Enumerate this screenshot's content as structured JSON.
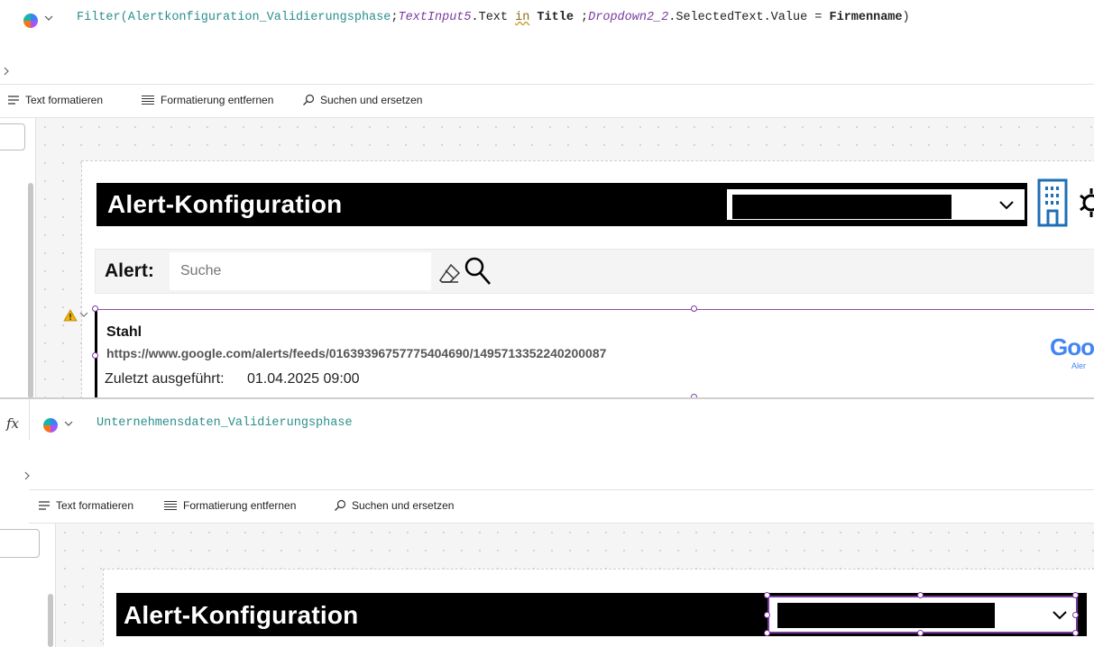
{
  "top_editor": {
    "formula": {
      "fn": "Filter(",
      "source": "Alertkonfiguration_Validierungsphase",
      "sep1": ";",
      "control1": "TextInput5",
      "prop1": ".Text ",
      "keyword_in": "in",
      "field1": " Title ",
      "sep2": ";",
      "control2": "Dropdown2_2",
      "prop2": ".SelectedText.Value = ",
      "field2": "Firmenname",
      "close": ")"
    },
    "toolbar": {
      "format_text": "Text formatieren",
      "remove_format": "Formatierung entfernen",
      "find_replace": "Suchen und ersetzen"
    },
    "app": {
      "title": "Alert-Konfiguration",
      "search_label": "Alert:",
      "search_placeholder": "Suche",
      "card": {
        "title": "Stahl",
        "url": "https://www.google.com/alerts/feeds/01639396757775404690/1495713352240200087",
        "last_run_label": "Zuletzt ausgeführt:",
        "last_run_value": "01.04.2025 09:00",
        "logo_text": "Goo",
        "logo_sub": "Aler"
      }
    }
  },
  "bottom_editor": {
    "fx_label": "fx",
    "formula": "Unternehmensdaten_Validierungsphase",
    "toolbar": {
      "format_text": "Text formatieren",
      "remove_format": "Formatierung entfernen",
      "find_replace": "Suchen und ersetzen"
    },
    "app": {
      "title": "Alert-Konfiguration"
    }
  },
  "colors": {
    "formula_teal": "#2a8f8c",
    "formula_purple": "#7b3a9e",
    "selection_purple": "#7b3a9e",
    "building_icon_blue": "#1f6fb5",
    "warning_yellow": "#f2b400"
  },
  "icons": [
    "copilot-icon",
    "chevron-down-icon",
    "chevron-right-icon",
    "format-text-icon",
    "remove-format-icon",
    "search-replace-icon",
    "building-icon",
    "gear-icon",
    "eraser-icon",
    "magnifier-icon",
    "warning-icon"
  ]
}
